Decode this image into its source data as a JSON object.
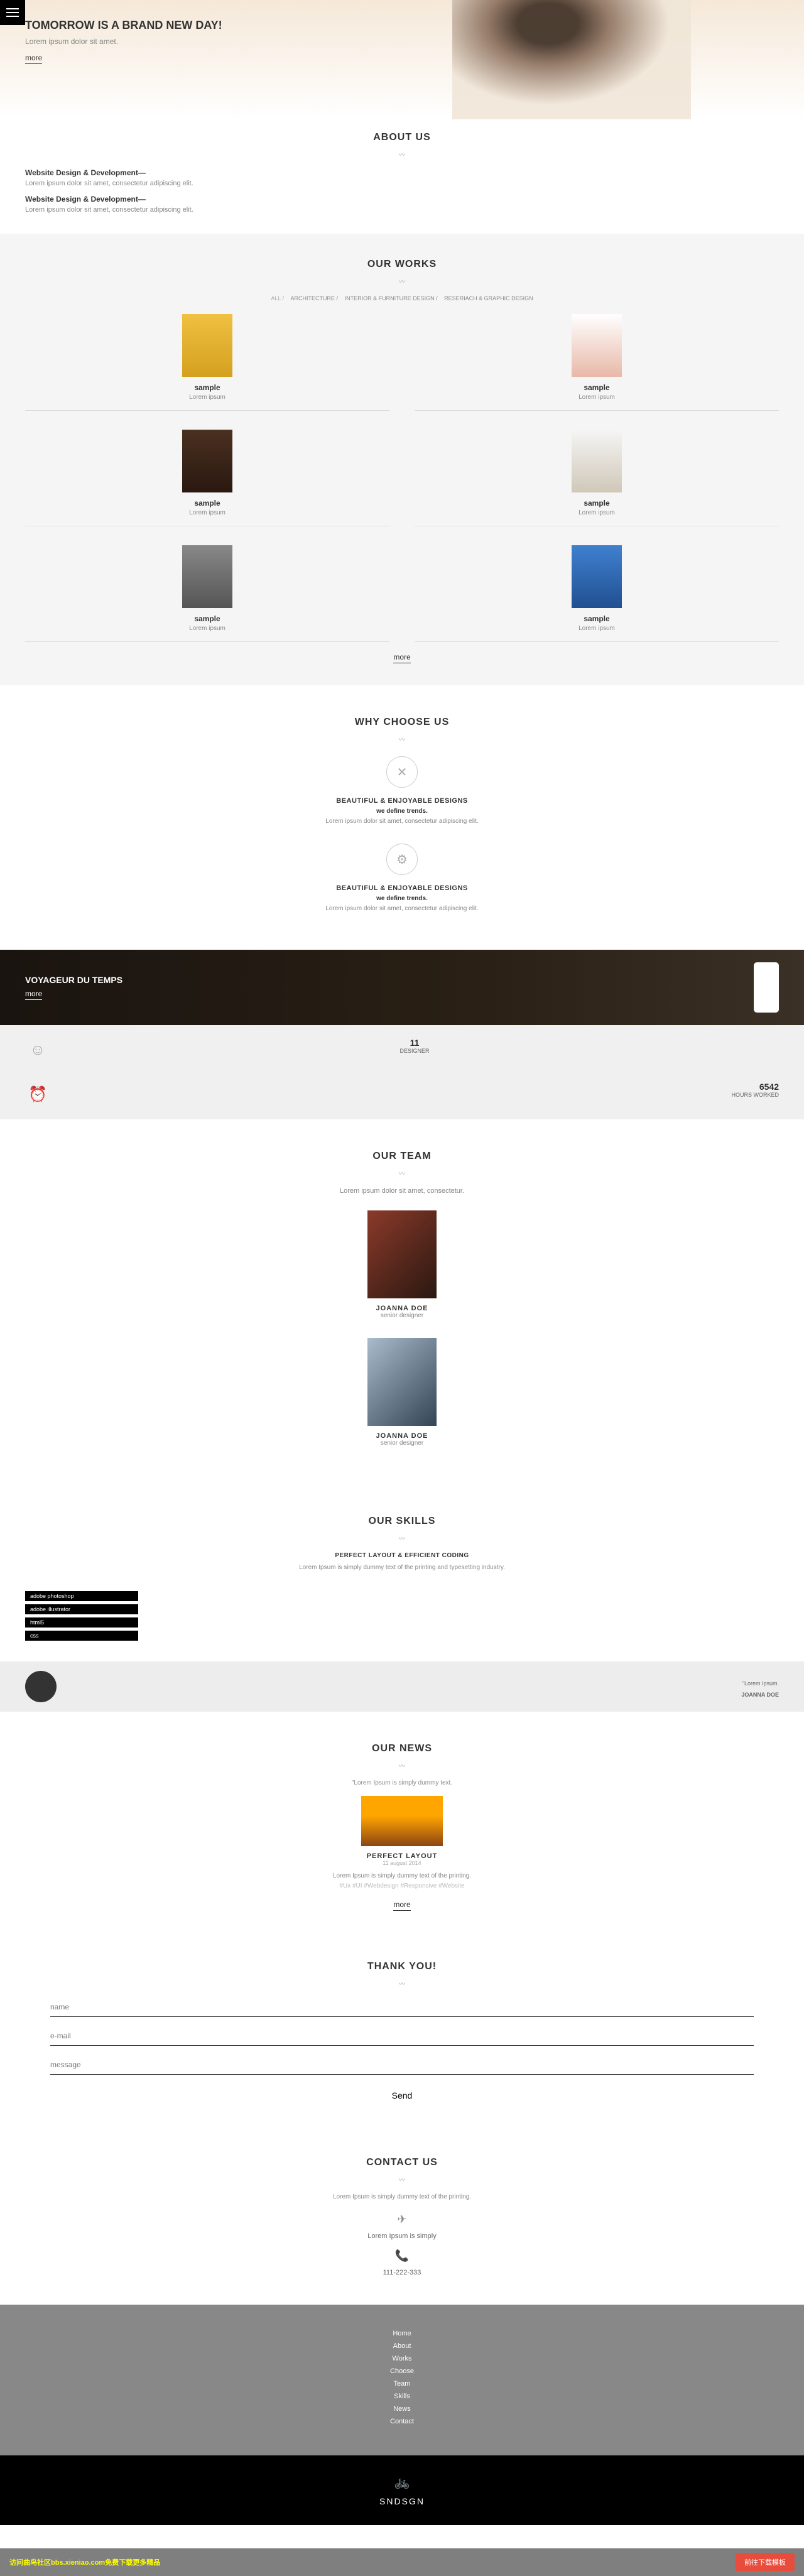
{
  "hero": {
    "title": "TOMORROW IS A BRAND NEW DAY!",
    "subtitle": "Lorem ipsum dolor sit amet.",
    "more": "more"
  },
  "about": {
    "title": "ABOUT US",
    "items": [
      {
        "title": "Website Design & Development—",
        "desc": "Lorem ipsum dolor sit amet, consectetur adipiscing elit."
      },
      {
        "title": "Website Design & Development—",
        "desc": "Lorem ipsum dolor sit amet, consectetur adipiscing elit."
      }
    ]
  },
  "works": {
    "title": "OUR WORKS",
    "filters": [
      "ALL /",
      "ARCHITECTURE /",
      "INTERIOR & FURNITURE DESIGN /",
      "RESERIACH & GRAPHIC DESIGN"
    ],
    "items": [
      {
        "title": "sample",
        "desc": "Lorem ipsum"
      },
      {
        "title": "sample",
        "desc": "Lorem ipsum"
      },
      {
        "title": "sample",
        "desc": "Lorem ipsum"
      },
      {
        "title": "sample",
        "desc": "Lorem ipsum"
      },
      {
        "title": "sample",
        "desc": "Lorem ipsum"
      },
      {
        "title": "sample",
        "desc": "Lorem ipsum"
      }
    ],
    "more": "more"
  },
  "choose": {
    "title": "WHY CHOOSE US",
    "items": [
      {
        "title": "BEAUTIFUL & ENJOYABLE DESIGNS",
        "sub": "we define trends.",
        "desc": "Lorem ipsum dolor sit amet, consectetur adipiscing elit."
      },
      {
        "title": "BEAUTIFUL & ENJOYABLE DESIGNS",
        "sub": "we define trends.",
        "desc": "Lorem ipsum dolor sit amet, consectetur adipiscing elit."
      }
    ]
  },
  "banner": {
    "title": "VOYAGEUR DU TEMPS",
    "more": "more"
  },
  "stats": {
    "stat1_num": "11",
    "stat1_label": "DESIGNER",
    "stat2_num": "6542",
    "stat2_label": "HOURS WORKED"
  },
  "team": {
    "title": "OUR TEAM",
    "intro": "Lorem ipsum dolor sit amet, consectetur.",
    "members": [
      {
        "name": "JOANNA DOE",
        "role": "senior designer"
      },
      {
        "name": "JOANNA DOE",
        "role": "senior designer"
      }
    ]
  },
  "skills": {
    "title": "OUR SKILLS",
    "subtitle": "PERFECT LAYOUT & EFFICIENT CODING",
    "desc": "Lorem Ipsum is simply dummy text of the printing and typesetting industry.",
    "bars": [
      "adobe photoshop",
      "adobe illustrator",
      "html5",
      "css"
    ]
  },
  "testimonial": {
    "quote": "\"Lorem Ipsum.",
    "name": "JOANNA DOE"
  },
  "news": {
    "title": "OUR NEWS",
    "quote": "\"Lorem Ipsum is simply dummy text.",
    "item_title": "PERFECT LAYOUT",
    "date": "11 august 2014",
    "desc": "Lorem Ipsum is simply dummy text of the printing.",
    "tags": "#Ux #UI #Webdesign #Responsive #Website",
    "more": "more"
  },
  "form": {
    "title": "THANK YOU!",
    "name_ph": "name",
    "email_ph": "e-mail",
    "message_ph": "message",
    "send": "Send"
  },
  "contact": {
    "title": "CONTACT US",
    "desc": "Lorem Ipsum is simply dummy text of the printing.",
    "info1": "Lorem Ipsum is simply",
    "phone": "111-222-333"
  },
  "footer": {
    "links": [
      "Home",
      "About",
      "Works",
      "Choose",
      "Team",
      "Skills",
      "News",
      "Contact"
    ],
    "brand": "SNDSGN"
  },
  "bottombar": {
    "text": "访问曲鸟社区bbs.xieniao.com免费下载更多精品",
    "btn": "前往下载模板"
  }
}
